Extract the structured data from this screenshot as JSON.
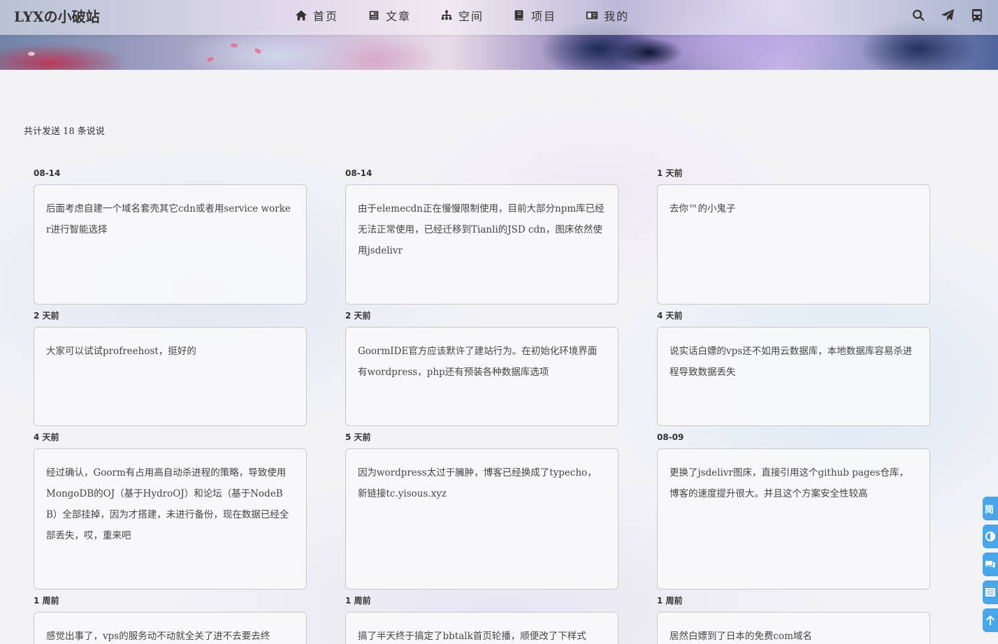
{
  "site": {
    "title": "LYXの小破站"
  },
  "nav": {
    "items": [
      {
        "label": "首页",
        "icon": "home-icon"
      },
      {
        "label": "文章",
        "icon": "newspaper-icon"
      },
      {
        "label": "空间",
        "icon": "sitemap-icon"
      },
      {
        "label": "项目",
        "icon": "book-icon"
      },
      {
        "label": "我的",
        "icon": "id-card-icon"
      }
    ],
    "tools": [
      "search-icon",
      "paper-plane-icon",
      "train-icon"
    ]
  },
  "summary": {
    "text": "共计发送 18 条说说"
  },
  "posts": [
    {
      "date": "08-14",
      "content": "后面考虑自建一个域名套壳其它cdn或者用service worker进行智能选择"
    },
    {
      "date": "08-14",
      "content": "由于elemecdn正在慢慢限制使用，目前大部分npm库已经无法正常使用，已经迁移到Tianli的JSD cdn，图床依然使用jsdelivr"
    },
    {
      "date": "1 天前",
      "content": "去你™的小鬼子"
    },
    {
      "date": "2 天前",
      "content": "大家可以试试profreehost，挺好的"
    },
    {
      "date": "2 天前",
      "content": "GoormIDE官方应该默许了建站行为。在初始化环境界面有wordpress，php还有预装各种数据库选项"
    },
    {
      "date": "4 天前",
      "content": "说实话白嫖的vps还不如用云数据库，本地数据库容易杀进程导致数据丢失"
    },
    {
      "date": "4 天前",
      "content": "经过确认，Goorm有占用高自动杀进程的策略，导致使用MongoDB的OJ（基于HydroOJ）和论坛（基于NodeBB）全部挂掉，因为才搭建，未进行备份，现在数据已经全部丢失，哎，重来吧"
    },
    {
      "date": "5 天前",
      "content": "因为wordpress太过于臃肿，博客已经换成了typecho，新链接tc.yisous.xyz"
    },
    {
      "date": "08-09",
      "content": "更换了jsdelivr图床，直接引用这个github pages仓库，博客的速度提升很大。并且这个方案安全性较高"
    },
    {
      "date": "1 周前",
      "content": "感觉出事了，vps的服务动不动就全关了进不去要去终"
    },
    {
      "date": "1 周前",
      "content": "搞了半天终于搞定了bbtalk首页轮播，顺便改了下样式"
    },
    {
      "date": "1 周前",
      "content": "居然白嫖到了日本的免费com域名"
    }
  ],
  "float_buttons": [
    {
      "label": "简",
      "icon": ""
    },
    {
      "label": "",
      "icon": "contrast-icon"
    },
    {
      "label": "",
      "icon": "comments-icon"
    },
    {
      "label": "",
      "icon": "list-icon"
    },
    {
      "label": "",
      "icon": "arrow-up-icon"
    }
  ]
}
